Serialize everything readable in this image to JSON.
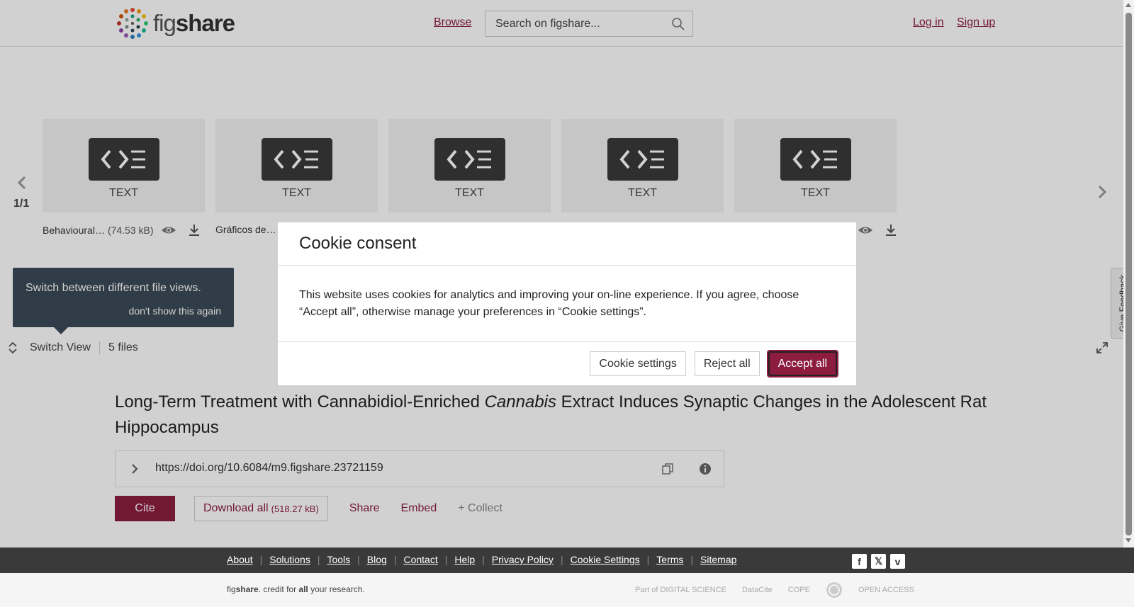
{
  "header": {
    "logo_prefix": "fig",
    "logo_bold": "share",
    "browse_label": "Browse",
    "search_placeholder": "Search on figshare...",
    "login_label": "Log in",
    "signup_label": "Sign up"
  },
  "viewer": {
    "pager": "1/1",
    "files": [
      {
        "type": "TEXT",
        "name": "Behavioural…",
        "size": "(74.53 kB)"
      },
      {
        "type": "TEXT",
        "name": "Gráficos de…",
        "size": ""
      },
      {
        "type": "TEXT",
        "name": "",
        "size": ""
      },
      {
        "type": "TEXT",
        "name": "",
        "size": ""
      },
      {
        "type": "TEXT",
        "name": "",
        "size": ""
      }
    ],
    "hint_text": "Switch between different file views.",
    "hint_dismiss": "don't show this again",
    "switch_view_label": "Switch View",
    "file_count": "5 files",
    "feedback_label": "Give Feedback"
  },
  "article": {
    "title_before": "Long-Term Treatment with Cannabidiol-Enriched ",
    "title_italic": "Cannabis",
    "title_after": " Extract Induces Synaptic Changes in the Adolescent Rat Hippocampus",
    "doi": "https://doi.org/10.6084/m9.figshare.23721159",
    "cite_label": "Cite",
    "download_label": "Download all",
    "download_size": "(518.27 kB)",
    "share_label": "Share",
    "embed_label": "Embed",
    "collect_label": "+ Collect"
  },
  "cookie_modal": {
    "title": "Cookie consent",
    "body": "This website uses cookies for analytics and improving your on-line experience. If you agree, choose “Accept all”, otherwise manage your preferences in “Cookie settings”.",
    "settings_label": "Cookie settings",
    "reject_label": "Reject all",
    "accept_label": "Accept all"
  },
  "footer": {
    "links": [
      "About",
      "Solutions",
      "Tools",
      "Blog",
      "Contact",
      "Help",
      "Privacy Policy",
      "Cookie Settings",
      "Terms",
      "Sitemap"
    ],
    "tagline_fig": "fig",
    "tagline_share": "share",
    "tagline_mid": ". credit for ",
    "tagline_all": "all",
    "tagline_end": " your research.",
    "partners": [
      "Part of DIGITAL SCIENCE",
      "DataCite",
      "COPE",
      "",
      "OPEN ACCESS"
    ]
  },
  "colors": {
    "brand": "#8c1d40",
    "footer_dark": "#3a3a3a",
    "hint_bg": "#3b4a57"
  }
}
